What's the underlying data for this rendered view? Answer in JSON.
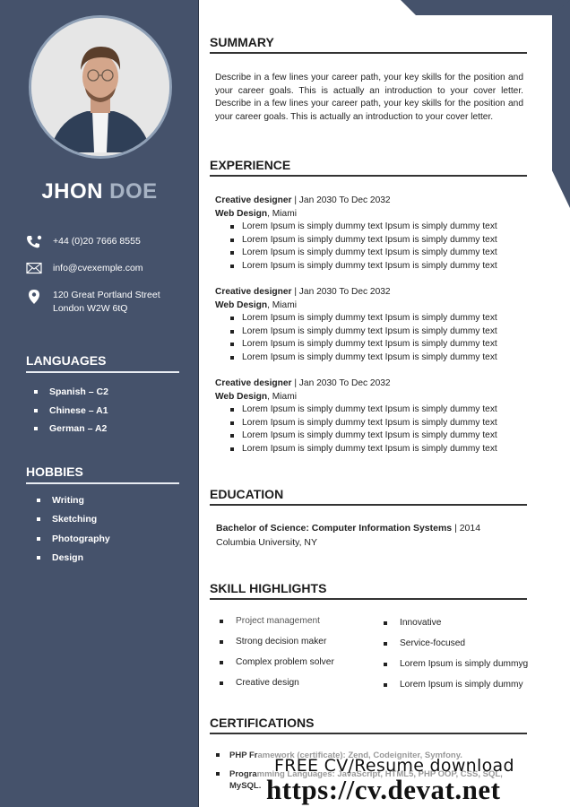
{
  "colors": {
    "sidebar": "#45526b",
    "last_name": "#a7b3c4",
    "heading_rule": "#333333"
  },
  "profile": {
    "first_name": "JHON",
    "last_name": "DOE",
    "photo_icon": "portrait-photo"
  },
  "contact": {
    "phone": "+44 (0)20 7666 8555",
    "phone_icon": "phone-icon",
    "email": "info@cvexemple.com",
    "email_icon": "envelope-icon",
    "address_line1": "120 Great Portland  Street",
    "address_line2": "London  W2W  6tQ",
    "address_icon": "map-pin-icon"
  },
  "languages": {
    "title": "LANGUAGES",
    "items": [
      "Spanish – C2",
      "Chinese – A1",
      "German – A2"
    ]
  },
  "hobbies": {
    "title": "HOBBIES",
    "items": [
      "Writing",
      "Sketching",
      "Photography",
      "Design"
    ]
  },
  "summary": {
    "title": "SUMMARY",
    "text": "Describe in a few lines your career path, your key skills for the position and your career goals. This is actually an introduction to your cover letter. Describe in a few lines your career path, your key skills for the position and your career goals. This is actually an introduction to your cover letter."
  },
  "experience": {
    "title": "EXPERIENCE",
    "jobs": [
      {
        "role": "Creative designer",
        "dates": " | Jan 2030  To Dec 2032",
        "company": "Web Design",
        "location": ", Miami",
        "bullets": [
          "Lorem Ipsum is simply dummy text Ipsum is simply dummy text",
          "Lorem Ipsum is simply dummy text Ipsum is simply dummy text",
          "Lorem Ipsum is simply dummy text Ipsum is simply dummy text",
          "Lorem Ipsum is simply dummy text Ipsum is simply dummy text"
        ]
      },
      {
        "role": "Creative designer",
        "dates": " | Jan 2030  To Dec 2032",
        "company": "Web Design",
        "location": ", Miami",
        "bullets": [
          "Lorem Ipsum is simply dummy text Ipsum is simply dummy text",
          "Lorem Ipsum is simply dummy text Ipsum is simply dummy text",
          "Lorem Ipsum is simply dummy text Ipsum is simply dummy text",
          "Lorem Ipsum is simply dummy text Ipsum is simply dummy text"
        ]
      },
      {
        "role": "Creative designer",
        "dates": " | Jan 2030  To Dec 2032",
        "company": "Web Design",
        "location": ", Miami",
        "bullets": [
          "Lorem Ipsum is simply dummy text Ipsum is simply dummy text",
          "Lorem Ipsum is simply dummy text Ipsum is simply dummy text",
          "Lorem Ipsum is simply dummy text Ipsum is simply dummy text",
          "Lorem Ipsum is simply dummy text Ipsum is simply dummy text"
        ]
      }
    ]
  },
  "education": {
    "title": "EDUCATION",
    "degree": "Bachelor of Science: Computer Information Systems",
    "year": " | 2014",
    "school": "Columbia University, NY"
  },
  "skills": {
    "title": "SKILL HIGHLIGHTS",
    "left": [
      "Project management",
      "Strong decision maker",
      "Complex problem solver",
      "Creative design"
    ],
    "right": [
      "Innovative",
      "Service-focused",
      "Lorem Ipsum is simply dummyg",
      "Lorem Ipsum is simply dummy"
    ]
  },
  "certifications": {
    "title": "CERTIFICATIONS",
    "items": [
      {
        "dark": "PHP Fr",
        "light": "amework (certificate): Zend, Codeigniter, Symfony."
      },
      {
        "dark": "Progra",
        "light": "mming Languages: JavaScript,  HTML5, PHP OOP, CSS, SQL,",
        "line2": "MySQL."
      }
    ]
  },
  "watermark": {
    "line1": "FREE CV/Resume download",
    "line2": "https://cv.devat.net"
  }
}
